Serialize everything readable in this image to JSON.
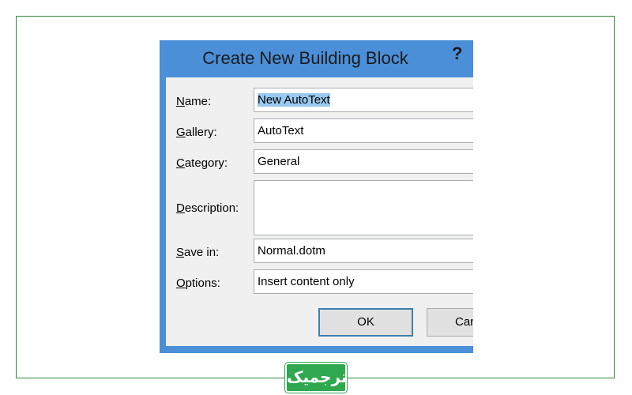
{
  "dialog": {
    "title": "Create New Building Block",
    "help_glyph": "?"
  },
  "fields": {
    "name": {
      "label_key": "N",
      "label_rest": "ame:",
      "value": "New AutoText"
    },
    "gallery": {
      "label_key": "G",
      "label_rest": "allery:",
      "value": "AutoText"
    },
    "category": {
      "label_key": "C",
      "label_rest": "ategory:",
      "value": "General"
    },
    "description": {
      "label_key": "D",
      "label_rest": "escription:",
      "value": ""
    },
    "save_in": {
      "label_key": "S",
      "label_rest": "ave in:",
      "value": "Normal.dotm"
    },
    "options": {
      "label_key": "O",
      "label_rest": "ptions:",
      "value": "Insert content only"
    }
  },
  "buttons": {
    "ok": "OK",
    "cancel": "Cancel"
  },
  "brand": {
    "logo_text": "ترجمیک",
    "frame_color": "#2e8b3a",
    "logo_color": "#2fa84f",
    "dialog_border_color": "#4a8fd8"
  }
}
